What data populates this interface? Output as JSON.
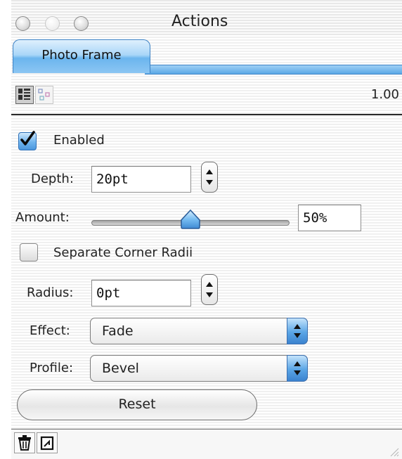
{
  "window": {
    "title": "Actions"
  },
  "tabs": [
    {
      "label": "Photo Frame",
      "active": true
    }
  ],
  "toolbar": {
    "zoom": "1.00"
  },
  "controls": {
    "enabled": {
      "label": "Enabled",
      "checked": true
    },
    "depth": {
      "label": "Depth:",
      "value": "20pt"
    },
    "amount": {
      "label": "Amount:",
      "value": "50%",
      "fraction": 0.5
    },
    "separate_corner_radii": {
      "label": "Separate Corner Radii",
      "checked": false
    },
    "radius": {
      "label": "Radius:",
      "value": "0pt"
    },
    "effect": {
      "label": "Effect:",
      "selected": "Fade"
    },
    "profile": {
      "label": "Profile:",
      "selected": "Bevel"
    },
    "reset_label": "Reset"
  },
  "icons": {
    "close": "close-window-icon",
    "minimize": "minimize-window-icon",
    "zoom": "zoom-window-icon",
    "list_view": "list-view-icon",
    "node_view": "node-view-icon",
    "trash": "trash-icon",
    "new": "new-item-icon",
    "resize": "resize-grip-icon"
  },
  "colors": {
    "aqua_blue": "#5aa8e6",
    "aqua_dark": "#3d82c4"
  }
}
